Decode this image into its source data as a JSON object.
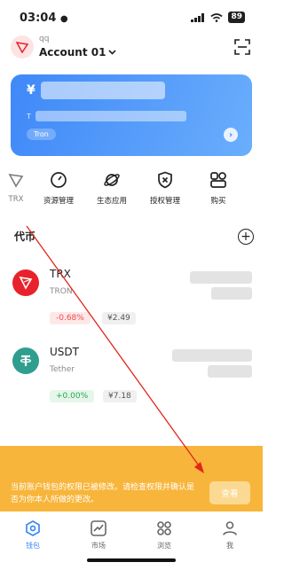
{
  "status": {
    "time": "03:04",
    "battery": "89"
  },
  "header": {
    "account_sub": "qq",
    "account_name": "Account 01"
  },
  "card": {
    "currency_symbol": "¥",
    "address_prefix": "T",
    "chain": "Tron"
  },
  "quick_actions": [
    {
      "label": "TRX",
      "icon": "trx-icon"
    },
    {
      "label": "资源管理",
      "icon": "gauge-icon"
    },
    {
      "label": "生态应用",
      "icon": "planet-icon"
    },
    {
      "label": "授权管理",
      "icon": "shield-x-icon"
    },
    {
      "label": "购买",
      "icon": "shopping-icon"
    }
  ],
  "tokens_section": {
    "title": "代币"
  },
  "tokens": [
    {
      "symbol": "TRX",
      "chain": "TRON",
      "change": "-0.68%",
      "price": "¥2.49",
      "change_color": "#f04b4b",
      "logo_color": "#e8222c"
    },
    {
      "symbol": "USDT",
      "chain": "Tether",
      "change": "+0.00%",
      "price": "¥7.18",
      "change_color": "#22a852",
      "logo_color": "#2f9e8f"
    }
  ],
  "notice": {
    "text": "当前账户钱包的权限已被修改。请检查权限并确认是否为你本人所做的更改。",
    "button": "查看"
  },
  "tabbar": [
    {
      "label": "钱包",
      "icon": "wallet-icon",
      "active": true
    },
    {
      "label": "市场",
      "icon": "market-icon",
      "active": false
    },
    {
      "label": "浏览",
      "icon": "browser-icon",
      "active": false
    },
    {
      "label": "我",
      "icon": "profile-icon",
      "active": false
    }
  ]
}
